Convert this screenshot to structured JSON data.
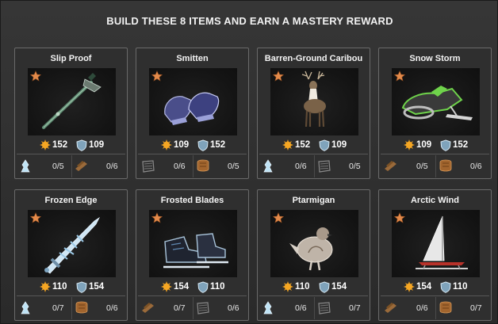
{
  "header": {
    "title": "BUILD THESE 8 ITEMS AND EARN A MASTERY REWARD"
  },
  "items": [
    {
      "name": "Slip Proof",
      "coins": "152",
      "xp": "109",
      "art": "ice-axe-icon",
      "materials": [
        {
          "icon": "ice-crystal-icon",
          "count": "0/5"
        },
        {
          "icon": "wood-plank-icon",
          "count": "0/6"
        }
      ]
    },
    {
      "name": "Smitten",
      "coins": "109",
      "xp": "152",
      "art": "mittens-icon",
      "materials": [
        {
          "icon": "fabric-icon",
          "count": "0/6"
        },
        {
          "icon": "leather-icon",
          "count": "0/5"
        }
      ]
    },
    {
      "name": "Barren-Ground Caribou",
      "coins": "152",
      "xp": "109",
      "art": "caribou-icon",
      "materials": [
        {
          "icon": "ice-crystal-icon",
          "count": "0/6"
        },
        {
          "icon": "fabric-icon",
          "count": "0/5"
        }
      ]
    },
    {
      "name": "Snow Storm",
      "coins": "109",
      "xp": "152",
      "art": "snowmobile-icon",
      "materials": [
        {
          "icon": "wood-plank-icon",
          "count": "0/5"
        },
        {
          "icon": "leather-icon",
          "count": "0/6"
        }
      ]
    },
    {
      "name": "Frozen Edge",
      "coins": "110",
      "xp": "154",
      "art": "ice-sword-icon",
      "materials": [
        {
          "icon": "ice-crystal-icon",
          "count": "0/7"
        },
        {
          "icon": "leather-icon",
          "count": "0/6"
        }
      ]
    },
    {
      "name": "Frosted Blades",
      "coins": "154",
      "xp": "110",
      "art": "ice-skate-icon",
      "materials": [
        {
          "icon": "wood-plank-icon",
          "count": "0/7"
        },
        {
          "icon": "fabric-icon",
          "count": "0/6"
        }
      ]
    },
    {
      "name": "Ptarmigan",
      "coins": "110",
      "xp": "154",
      "art": "ptarmigan-icon",
      "materials": [
        {
          "icon": "ice-crystal-icon",
          "count": "0/6"
        },
        {
          "icon": "fabric-icon",
          "count": "0/7"
        }
      ]
    },
    {
      "name": "Arctic Wind",
      "coins": "154",
      "xp": "110",
      "art": "ice-boat-icon",
      "materials": [
        {
          "icon": "wood-plank-icon",
          "count": "0/6"
        },
        {
          "icon": "leather-icon",
          "count": "0/7"
        }
      ]
    }
  ],
  "colors": {
    "star": "#e38a4a",
    "coin": "#f5a623",
    "shield": "#8fb3c9",
    "text": "#ffffff"
  }
}
